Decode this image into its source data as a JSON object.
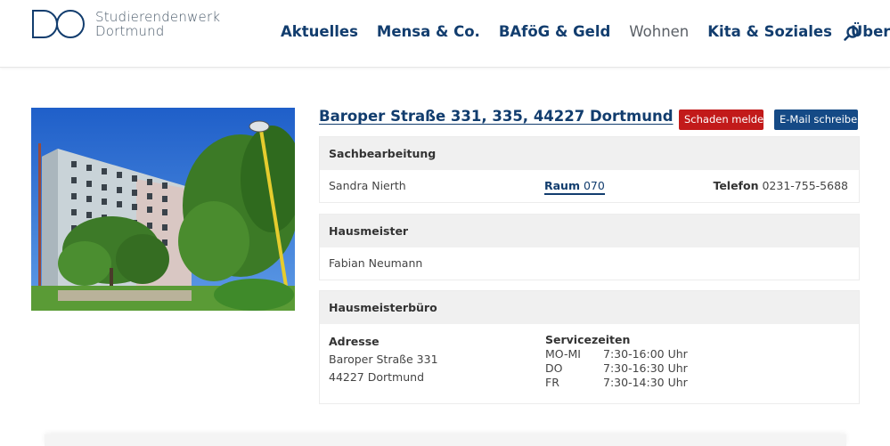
{
  "header": {
    "logo": {
      "line1": "Studierendenwerk",
      "line2": "Dortmund",
      "color": "#123d6e"
    },
    "nav": [
      {
        "label": "Aktuelles"
      },
      {
        "label": "Mensa & Co."
      },
      {
        "label": "BAföG & Geld"
      },
      {
        "label": "Wohnen"
      },
      {
        "label": "Kita & Soziales"
      },
      {
        "label": "Über uns"
      }
    ],
    "search_icon": "search-icon"
  },
  "listing": {
    "address": "Baroper Straße 331, 335, 44227 Dortmund",
    "report_damage_label": "Schaden melden",
    "email_label": "E-Mail schreiben",
    "colors": {
      "primary": "#123d6e",
      "danger": "#c21a1a",
      "button_blue": "#154a86"
    }
  },
  "sachbearbeitung": {
    "title": "Sachbearbeitung",
    "name": "Sandra Nierth",
    "raum_label": "Raum",
    "raum_value": "070",
    "telefon_label": "Telefon",
    "telefon_value": "0231-755-5688"
  },
  "hausmeister": {
    "title": "Hausmeister",
    "name": "Fabian Neumann"
  },
  "hausmeisterbuero": {
    "title": "Hausmeisterbüro",
    "adresse_label": "Adresse",
    "street": "Baroper Straße 331",
    "city": "44227 Dortmund",
    "service_label": "Servicezeiten",
    "times": [
      {
        "day": "MO-MI",
        "time": "7:30-16:00 Uhr"
      },
      {
        "day": "DO",
        "time": "7:30-16:30 Uhr"
      },
      {
        "day": "FR",
        "time": "7:30-14:30 Uhr"
      }
    ]
  }
}
